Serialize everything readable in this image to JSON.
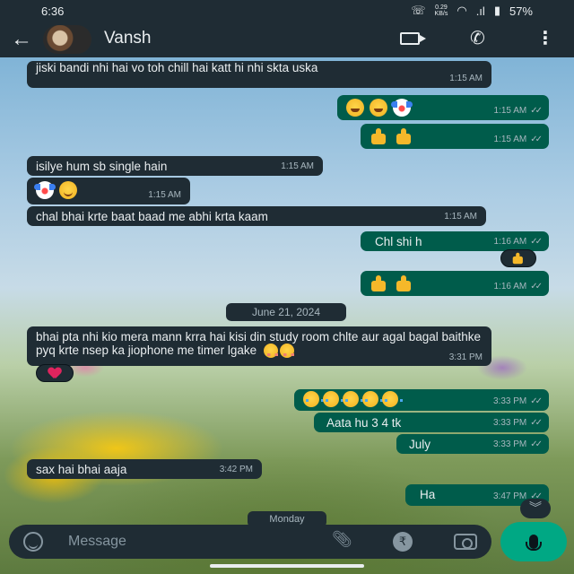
{
  "status_bar": {
    "time": "6:36",
    "speed_value": "0.29",
    "speed_unit": "KB/s",
    "battery": "57%"
  },
  "header": {
    "contact_name": "Vansh",
    "icons": [
      "back-arrow-icon",
      "video-call-icon",
      "voice-call-icon",
      "more-options-icon"
    ]
  },
  "messages": [
    {
      "dir": "in",
      "text": "jiski bandi nhi hai vo toh chill hai katt hi nhi skta uska",
      "time": "1:15 AM"
    },
    {
      "dir": "out",
      "emoji": [
        "laughing",
        "laughing",
        "clown"
      ],
      "time": "1:15 AM"
    },
    {
      "dir": "out",
      "emoji": [
        "thumbs-up",
        "thumbs-up"
      ],
      "time": "1:15 AM"
    },
    {
      "dir": "in",
      "text": "isilye hum sb single hain",
      "time": "1:15 AM"
    },
    {
      "dir": "in",
      "emoji": [
        "clown",
        "smiling"
      ],
      "time": "1:15 AM"
    },
    {
      "dir": "in",
      "text": "chal bhai krte baat baad me abhi krta kaam",
      "time": "1:15 AM"
    },
    {
      "dir": "out",
      "text": "Chl shi h",
      "time": "1:16 AM",
      "reaction": "thumbs-up"
    },
    {
      "dir": "out",
      "emoji": [
        "thumbs-up",
        "thumbs-up"
      ],
      "time": "1:16 AM"
    },
    {
      "dir": "in",
      "text": "bhai pta nhi kio mera mann krra hai kisi din study room chlte aur agal bagal baithke pyq krte nsep ka jiophone me timer lgake",
      "emoji": [
        "blushing",
        "blushing"
      ],
      "time": "3:31 PM",
      "reaction": "heart"
    },
    {
      "dir": "out",
      "emoji": [
        "pleading",
        "pleading",
        "pleading",
        "pleading",
        "pleading"
      ],
      "time": "3:33 PM"
    },
    {
      "dir": "out",
      "text": "Aata hu 3 4 tk",
      "time": "3:33 PM"
    },
    {
      "dir": "out",
      "text": "July",
      "time": "3:33 PM"
    },
    {
      "dir": "in",
      "text": "sax hai bhai aaja",
      "time": "3:42 PM"
    },
    {
      "dir": "out",
      "text": "Ha",
      "time": "3:47 PM"
    }
  ],
  "date_separator": "June 21, 2024",
  "day_separator": "Monday",
  "composer": {
    "placeholder": "Message"
  },
  "colors": {
    "incoming_bubble": "#1f2c34",
    "outgoing_bubble": "#005c4b",
    "accent": "#00a884"
  }
}
